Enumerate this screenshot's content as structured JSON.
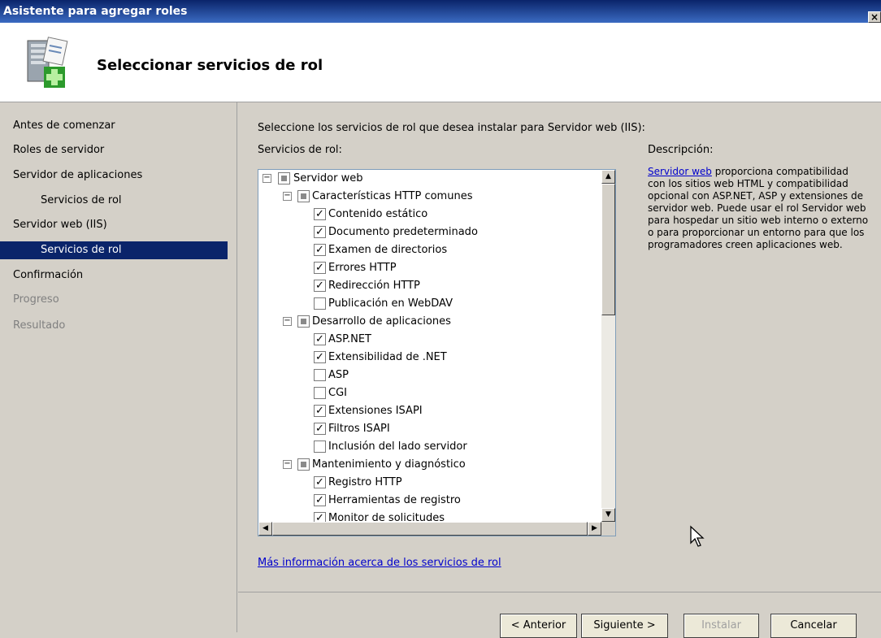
{
  "window": {
    "title": "Asistente para agregar roles",
    "close_label": "×"
  },
  "header": {
    "title": "Seleccionar servicios de rol"
  },
  "sidebar": {
    "items": [
      {
        "label": "Antes de comenzar",
        "state": "normal"
      },
      {
        "label": "Roles de servidor",
        "state": "normal"
      },
      {
        "label": "Servidor de aplicaciones",
        "state": "normal"
      },
      {
        "label": "Servicios de rol",
        "state": "normal"
      },
      {
        "label": "Servidor web (IIS)",
        "state": "normal"
      },
      {
        "label": "Servicios de rol",
        "state": "selected"
      },
      {
        "label": "Confirmación",
        "state": "normal"
      },
      {
        "label": "Progreso",
        "state": "disabled"
      },
      {
        "label": "Resultado",
        "state": "disabled"
      }
    ]
  },
  "main": {
    "intro": "Seleccione los servicios de rol que desea instalar para Servidor web (IIS):",
    "services_label": "Servicios de rol:",
    "description_label": "Descripción:",
    "description_link": "Servidor web",
    "description_text": " proporciona compatibilidad con los sitios web HTML y compatibilidad opcional con ASP.NET, ASP y extensiones de servidor web. Puede usar el rol Servidor web para hospedar un sitio web interno o externo o para proporcionar un entorno para que los programadores creen aplicaciones web.",
    "more_info_link": "Más información acerca de los servicios de rol",
    "tree": [
      {
        "label": "Servidor web",
        "level": 0,
        "state": "partial",
        "expander": "−"
      },
      {
        "label": "Características HTTP comunes",
        "level": 1,
        "state": "partial",
        "expander": "−"
      },
      {
        "label": "Contenido estático",
        "level": 2,
        "state": "checked"
      },
      {
        "label": "Documento predeterminado",
        "level": 2,
        "state": "checked"
      },
      {
        "label": "Examen de directorios",
        "level": 2,
        "state": "checked"
      },
      {
        "label": "Errores HTTP",
        "level": 2,
        "state": "checked"
      },
      {
        "label": "Redirección HTTP",
        "level": 2,
        "state": "checked"
      },
      {
        "label": "Publicación en WebDAV",
        "level": 2,
        "state": "unchecked"
      },
      {
        "label": "Desarrollo de aplicaciones",
        "level": 1,
        "state": "partial",
        "expander": "−"
      },
      {
        "label": "ASP.NET",
        "level": 2,
        "state": "checked"
      },
      {
        "label": "Extensibilidad de .NET",
        "level": 2,
        "state": "checked"
      },
      {
        "label": "ASP",
        "level": 2,
        "state": "unchecked"
      },
      {
        "label": "CGI",
        "level": 2,
        "state": "unchecked"
      },
      {
        "label": "Extensiones ISAPI",
        "level": 2,
        "state": "checked"
      },
      {
        "label": "Filtros ISAPI",
        "level": 2,
        "state": "checked"
      },
      {
        "label": "Inclusión del lado servidor",
        "level": 2,
        "state": "unchecked"
      },
      {
        "label": "Mantenimiento y diagnóstico",
        "level": 1,
        "state": "partial",
        "expander": "−"
      },
      {
        "label": "Registro HTTP",
        "level": 2,
        "state": "checked"
      },
      {
        "label": "Herramientas de registro",
        "level": 2,
        "state": "checked"
      },
      {
        "label": "Monitor de solicitudes",
        "level": 2,
        "state": "checked"
      }
    ]
  },
  "buttons": {
    "back": "< Anterior",
    "next": "Siguiente >",
    "install": "Instalar",
    "cancel": "Cancelar"
  },
  "colors": {
    "selection": "#0a246a",
    "link": "#0000cc"
  }
}
